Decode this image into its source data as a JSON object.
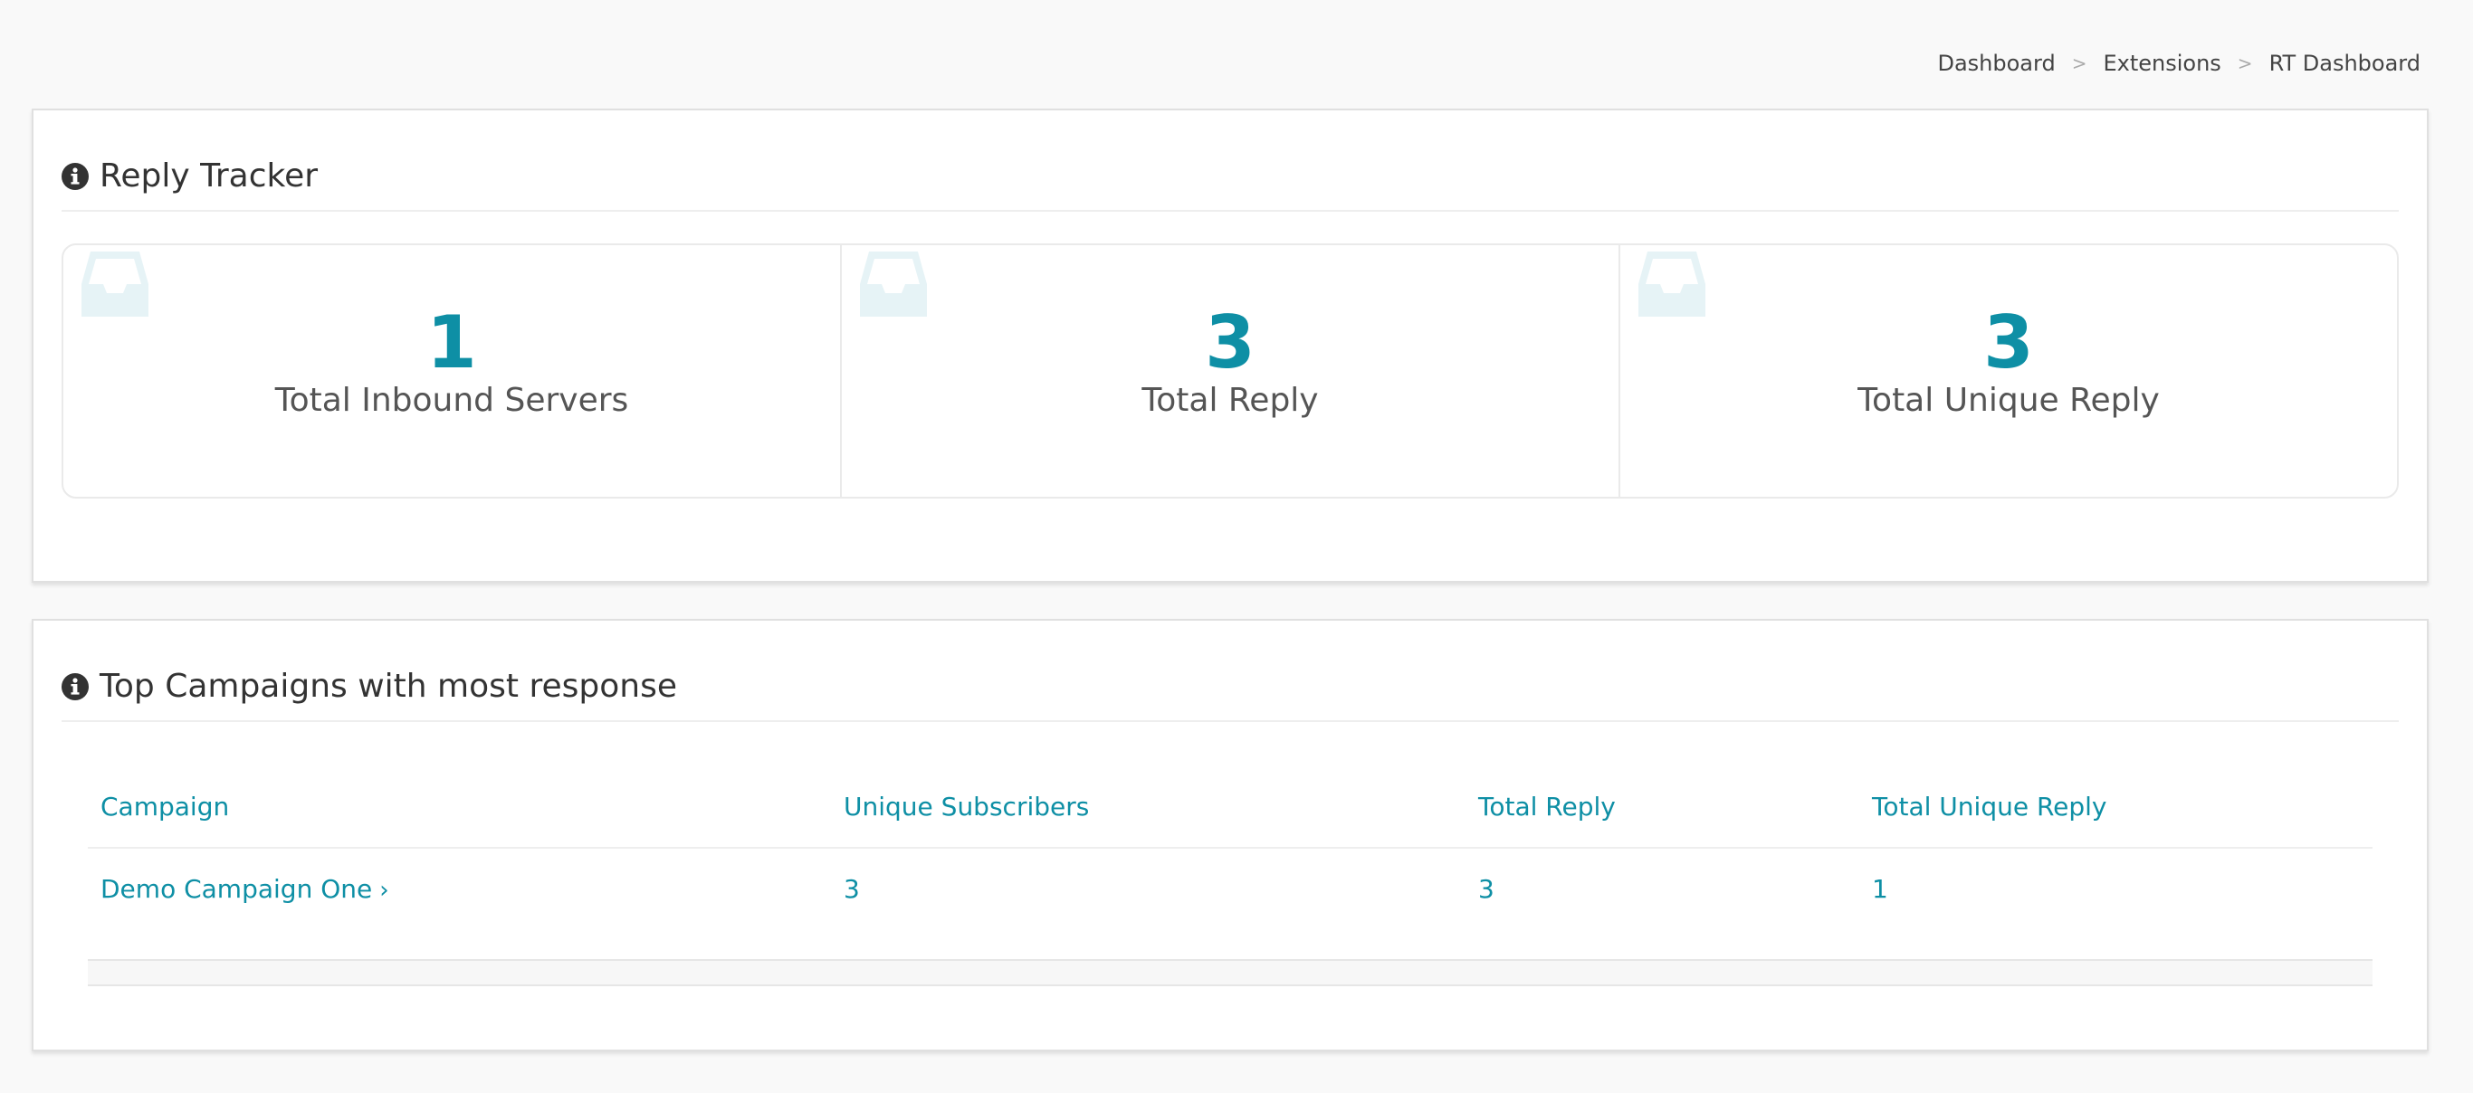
{
  "breadcrumb": {
    "items": [
      "Dashboard",
      "Extensions",
      "RT Dashboard"
    ],
    "separator": ">"
  },
  "reply_tracker": {
    "title": "Reply Tracker",
    "stats": [
      {
        "value": "1",
        "label": "Total Inbound Servers"
      },
      {
        "value": "3",
        "label": "Total Reply"
      },
      {
        "value": "3",
        "label": "Total Unique Reply"
      }
    ]
  },
  "top_campaigns": {
    "title": "Top Campaigns with most response",
    "columns": [
      "Campaign",
      "Unique Subscribers",
      "Total Reply",
      "Total Unique Reply"
    ],
    "rows": [
      {
        "campaign": "Demo Campaign One",
        "unique_subscribers": "3",
        "total_reply": "3",
        "total_unique_reply": "1"
      }
    ]
  },
  "colors": {
    "accent": "#0e8fa5",
    "background": "#f9f9f9",
    "icon_faded": "#e6f3f6"
  },
  "icons": {
    "section_icon": "info-circle-icon",
    "stat_icon": "inbox-icon",
    "row_icon": "chevron-right-icon"
  }
}
